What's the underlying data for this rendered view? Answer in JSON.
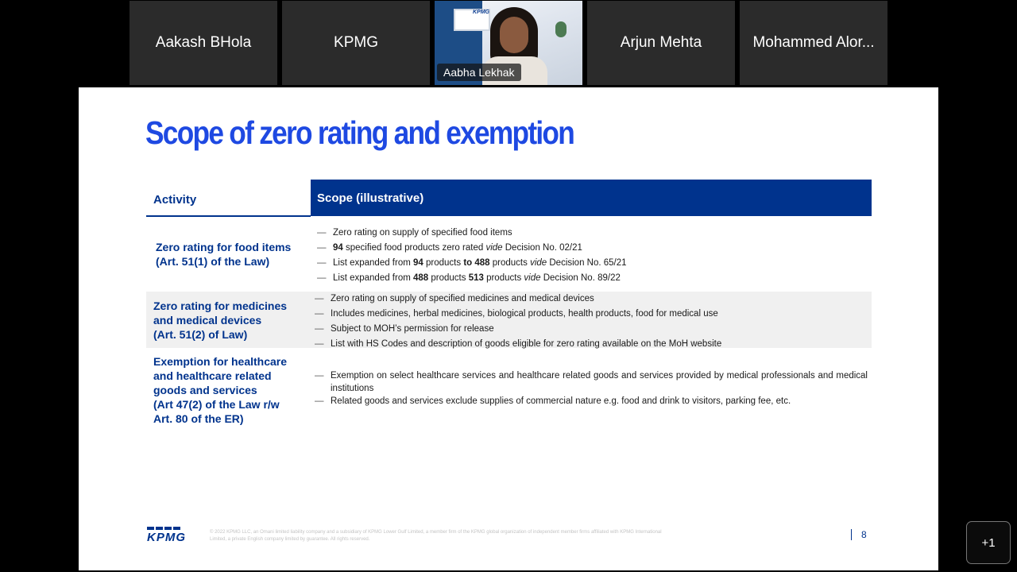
{
  "participants": [
    {
      "name": "Aakash BHola"
    },
    {
      "name": "KPMG"
    },
    {
      "name": "Aabha Lekhak",
      "video_logo": "KPMG"
    },
    {
      "name": "Arjun Mehta"
    },
    {
      "name": "Mohammed Alor..."
    }
  ],
  "slide": {
    "title": "Scope of zero rating and exemption",
    "col_activity": "Activity",
    "col_scope": "Scope (illustrative)",
    "rows": [
      {
        "label_lines": [
          "Zero rating for food items",
          "(Art. 51(1) of the Law)"
        ],
        "items": [
          [
            {
              "t": "Zero rating on supply of specified food items"
            }
          ],
          [
            {
              "t": "94",
              "b": true
            },
            {
              "t": " specified food products zero rated "
            },
            {
              "t": "vide",
              "i": true
            },
            {
              "t": " Decision No. 02/21"
            }
          ],
          [
            {
              "t": "List expanded from "
            },
            {
              "t": "94",
              "b": true
            },
            {
              "t": " products "
            },
            {
              "t": "to 488",
              "b": true
            },
            {
              "t": " products "
            },
            {
              "t": "vide",
              "i": true
            },
            {
              "t": " Decision No. 65/21"
            }
          ],
          [
            {
              "t": "List expanded from "
            },
            {
              "t": "488",
              "b": true
            },
            {
              "t": " products "
            },
            {
              "t": "513",
              "b": true
            },
            {
              "t": " products "
            },
            {
              "t": "vide",
              "i": true
            },
            {
              "t": " Decision No. 89/22"
            }
          ]
        ]
      },
      {
        "label_lines": [
          "Zero rating for medicines",
          "and medical devices",
          "(Art. 51(2) of Law)"
        ],
        "items": [
          [
            {
              "t": "Zero rating on supply of specified medicines and medical devices"
            }
          ],
          [
            {
              "t": "Includes medicines, herbal medicines, biological products, health products, food for medical use"
            }
          ],
          [
            {
              "t": "Subject to MOH’s permission for release"
            }
          ],
          [
            {
              "t": "List with HS Codes and description of goods eligible for zero rating available on the MoH website"
            }
          ]
        ]
      },
      {
        "label_lines": [
          "Exemption for healthcare",
          "and healthcare related",
          "goods and services",
          "(Art 47(2) of the Law r/w",
          "Art. 80 of the ER)"
        ],
        "items": [
          [
            {
              "t": "Exemption on select healthcare services and healthcare related goods and services provided by medical professionals and medical institutions"
            }
          ],
          [
            {
              "t": "Related goods and services exclude supplies of commercial nature e.g. food and drink to visitors, parking fee, etc."
            }
          ]
        ]
      }
    ],
    "footer_logo": "KPMG",
    "footer_legal": "© 2022 KPMG LLC, an Omani limited liability company and a subsidiary of KPMG Lower Gulf Limited, a member firm of the KPMG global organization of independent member firms affiliated with KPMG International Limited, a private English company limited by guarantee. All rights reserved.",
    "page_number": "8"
  },
  "overflow_badge": "+1"
}
